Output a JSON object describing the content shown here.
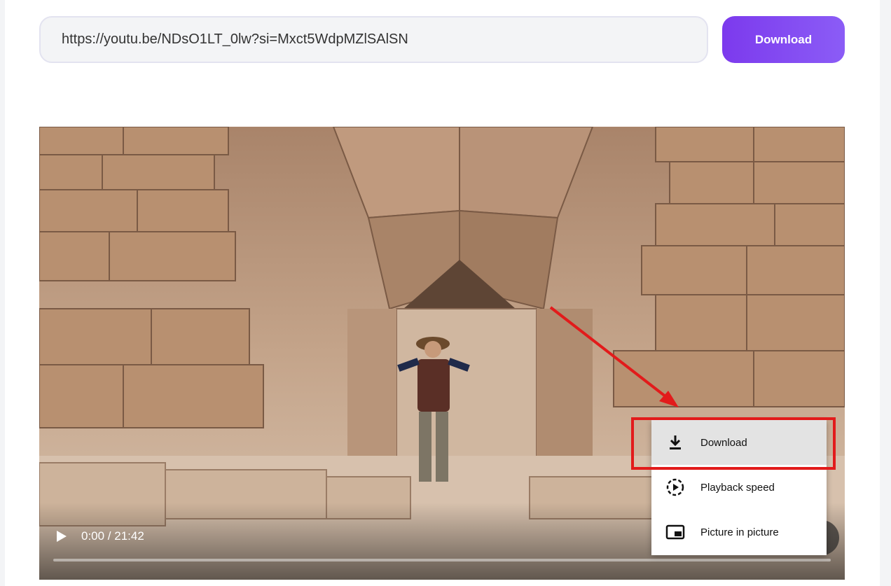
{
  "url_input": {
    "value": "https://youtu.be/NDsO1LT_0lw?si=Mxct5WdpMZlSAlSN"
  },
  "download_button": {
    "label": "Download"
  },
  "video": {
    "time": "0:00 / 21:42",
    "progress": 0
  },
  "context_menu": {
    "items": [
      {
        "label": "Download",
        "icon": "download-icon",
        "highlighted": true
      },
      {
        "label": "Playback speed",
        "icon": "playback-speed-icon",
        "highlighted": false
      },
      {
        "label": "Picture in picture",
        "icon": "picture-in-picture-icon",
        "highlighted": false
      }
    ]
  },
  "colors": {
    "accent": "#7c3aed",
    "annotation": "#e21b1b"
  }
}
